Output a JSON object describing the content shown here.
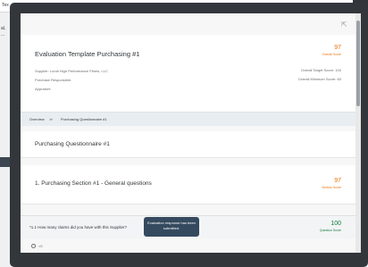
{
  "background": {
    "top_text": "Tex",
    "left_text_1": "al,",
    "left_text_2": "..."
  },
  "modal": {
    "header": {
      "title": "Evaluation Template Purchasing #1",
      "supplier": "Supplier: Lundi High Performance Fibers, LLC",
      "purchase_responsible": "Purchase Responsible:",
      "appraiser": "Appraiser:",
      "overall_score": "97",
      "overall_score_label": "Overall Score",
      "target_score": "Overall Target Score: 100",
      "minimum_score": "Overall Minimum Score: 60"
    },
    "breadcrumb": {
      "items": [
        "Overview",
        "Purchasing Questionnaire #1"
      ],
      "separator": "≫"
    },
    "questionnaire": {
      "title": "Purchasing Questionnaire #1"
    },
    "section": {
      "title": "1. Purchasing Section #1 - General questions",
      "score": "97",
      "score_label": "Section Score"
    },
    "question": {
      "text": "*1.1 How many claims did you have with this Supplier?",
      "score": "100",
      "score_label": "Question Score"
    },
    "answer_option": "<5"
  },
  "toast": {
    "message": "Evaluation response has been submitted."
  },
  "colors": {
    "accent_orange": "#e9730c",
    "accent_green": "#107e3e",
    "toast_bg": "#354a5f"
  }
}
